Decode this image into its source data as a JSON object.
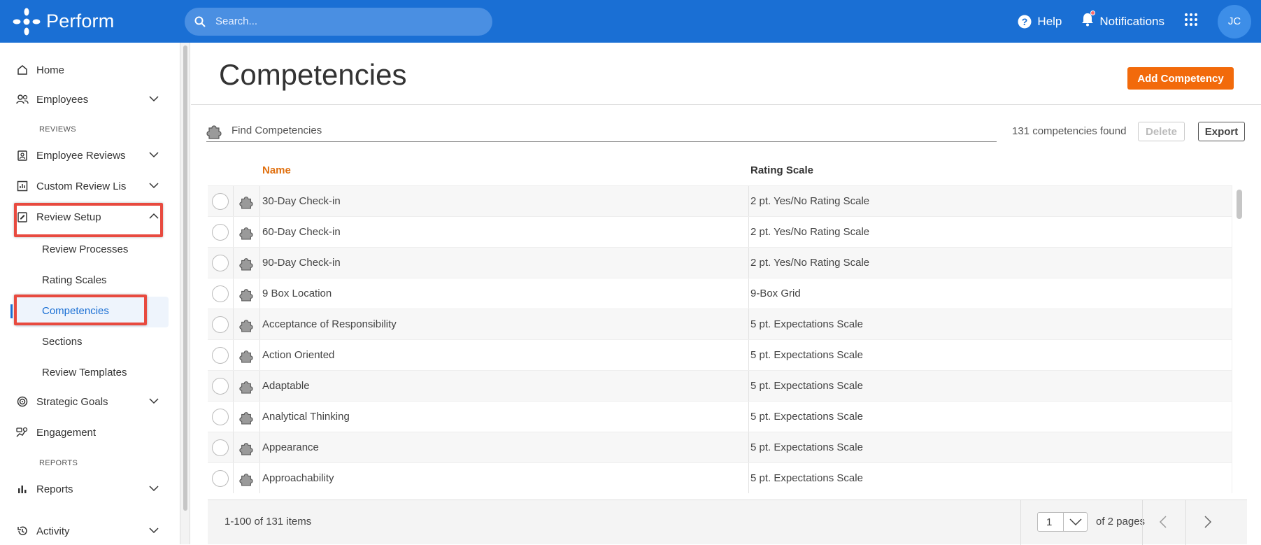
{
  "app": {
    "name": "Perform"
  },
  "header": {
    "search_placeholder": "Search...",
    "help_label": "Help",
    "notifications_label": "Notifications",
    "avatar_initials": "JC"
  },
  "sidebar": {
    "items": {
      "home": "Home",
      "employees": "Employees",
      "reviews_section": "REVIEWS",
      "employee_reviews": "Employee Reviews",
      "custom_review_lists": "Custom Review Lis",
      "review_setup": "Review Setup",
      "review_processes": "Review Processes",
      "rating_scales": "Rating Scales",
      "competencies": "Competencies",
      "sections": "Sections",
      "review_templates": "Review Templates",
      "strategic_goals": "Strategic Goals",
      "engagement": "Engagement",
      "reports_section": "REPORTS",
      "reports": "Reports",
      "activity": "Activity"
    }
  },
  "main": {
    "title": "Competencies",
    "add_button": "Add Competency",
    "find_placeholder": "Find Competencies",
    "count_text": "131 competencies found",
    "delete_button": "Delete",
    "export_button": "Export",
    "columns": {
      "name": "Name",
      "rating": "Rating Scale"
    },
    "rows": [
      {
        "name": "30-Day Check-in",
        "rating": "2 pt. Yes/No Rating Scale"
      },
      {
        "name": "60-Day Check-in",
        "rating": "2 pt. Yes/No Rating Scale"
      },
      {
        "name": "90-Day Check-in",
        "rating": "2 pt. Yes/No Rating Scale"
      },
      {
        "name": "9 Box Location",
        "rating": "9-Box Grid"
      },
      {
        "name": "Acceptance of Responsibility",
        "rating": "5 pt. Expectations Scale"
      },
      {
        "name": "Action Oriented",
        "rating": "5 pt. Expectations Scale"
      },
      {
        "name": "Adaptable",
        "rating": "5 pt. Expectations Scale"
      },
      {
        "name": "Analytical Thinking",
        "rating": "5 pt. Expectations Scale"
      },
      {
        "name": "Appearance",
        "rating": "5 pt. Expectations Scale"
      },
      {
        "name": "Approachability",
        "rating": "5 pt. Expectations Scale"
      }
    ],
    "pager": {
      "items_text": "1-100 of 131 items",
      "current_page": "1",
      "of_pages": "of 2 pages"
    }
  },
  "colors": {
    "brand": "#1a6fd4",
    "accent": "#f26a0b",
    "highlight": "#e84a3f"
  }
}
